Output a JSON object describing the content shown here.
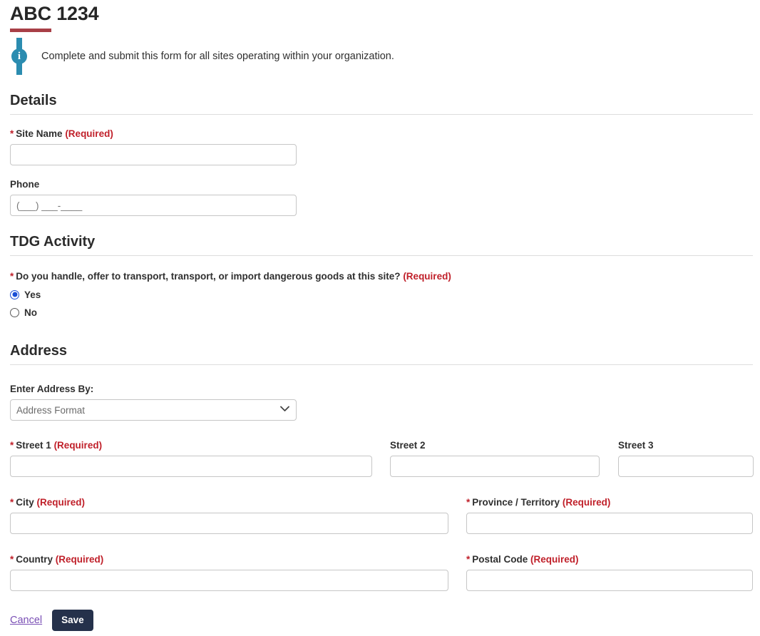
{
  "header": {
    "title": "ABC 1234",
    "accent_color": "#a83f47",
    "info_icon": "info-circle-icon",
    "info_icon_glyph": "i",
    "info_color": "#2b8cb0",
    "info_text": "Complete and submit this form for all sites operating within your organization."
  },
  "required_marker": "*",
  "required_text": "(Required)",
  "sections": {
    "details": {
      "heading": "Details",
      "site_name": {
        "label": "Site Name",
        "required": "(Required)",
        "value": "",
        "placeholder": ""
      },
      "phone": {
        "label": "Phone",
        "value": "",
        "placeholder": "(___) ___-____"
      }
    },
    "tdg": {
      "heading": "TDG Activity",
      "question": "Do you handle, offer to transport, transport, or import dangerous goods at this site?",
      "required": "(Required)",
      "options": [
        {
          "label": "Yes",
          "selected": true
        },
        {
          "label": "No",
          "selected": false
        }
      ]
    },
    "address": {
      "heading": "Address",
      "format_label": "Enter Address By:",
      "format_value": "Address Format",
      "format_options": [
        "Address Format"
      ],
      "chevron_icon": "chevron-down-icon",
      "street1": {
        "label": "Street 1",
        "required": "(Required)",
        "value": ""
      },
      "street2": {
        "label": "Street 2",
        "required": "",
        "value": ""
      },
      "street3": {
        "label": "Street 3",
        "required": "",
        "value": ""
      },
      "city": {
        "label": "City",
        "required": "(Required)",
        "value": ""
      },
      "province": {
        "label": "Province / Territory",
        "required": "(Required)",
        "value": ""
      },
      "country": {
        "label": "Country",
        "required": "(Required)",
        "value": ""
      },
      "postal_code": {
        "label": "Postal Code",
        "required": "(Required)",
        "value": ""
      }
    }
  },
  "footer": {
    "cancel_label": "Cancel",
    "save_label": "Save",
    "save_color": "#25314b",
    "cancel_color": "#7a4fb5"
  }
}
